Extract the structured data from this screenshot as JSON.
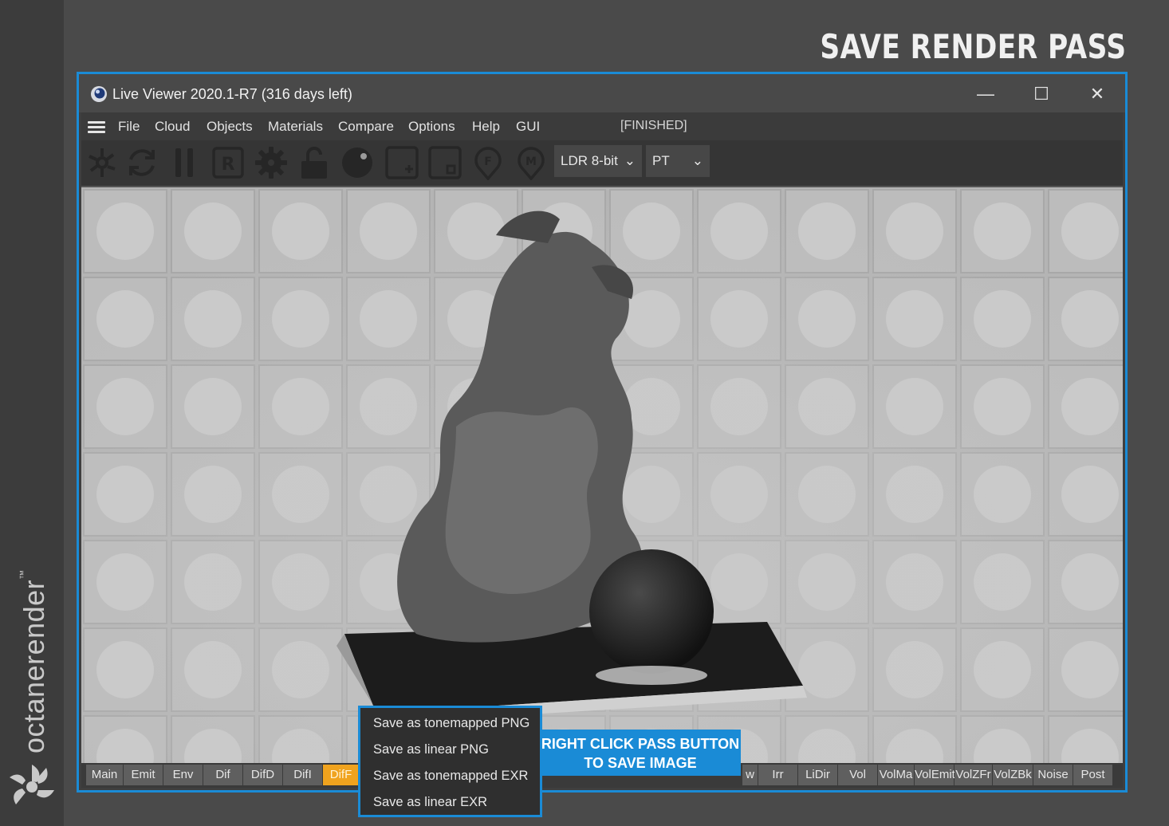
{
  "brand": {
    "name": "octanerender",
    "trademark": "™"
  },
  "page_title": "SAVE RENDER PASS",
  "window": {
    "title": "Live Viewer 2020.1-R7 (316 days left)",
    "minimize_glyph": "—",
    "maximize_glyph": "☐",
    "close_glyph": "✕"
  },
  "menu": {
    "items": [
      "File",
      "Cloud",
      "Objects",
      "Materials",
      "Compare",
      "Options",
      "Help",
      "GUI"
    ],
    "status": "[FINISHED]"
  },
  "toolbar": {
    "tools": [
      {
        "icon": "send-to-render-icon"
      },
      {
        "icon": "reset-icon"
      },
      {
        "icon": "pause-icon"
      },
      {
        "icon": "region-render-icon",
        "letter": "R"
      },
      {
        "icon": "settings-gear-icon"
      },
      {
        "icon": "unlock-icon"
      },
      {
        "icon": "clay-mode-icon"
      },
      {
        "icon": "add-region-icon"
      },
      {
        "icon": "subtract-region-icon"
      },
      {
        "icon": "focus-picker-icon",
        "letter": "F"
      },
      {
        "icon": "material-picker-icon",
        "letter": "M"
      }
    ],
    "color_depth": "LDR 8-bit",
    "render_mode": "PT"
  },
  "passes": {
    "left": [
      "Main",
      "Emit",
      "Env",
      "Dif",
      "DifD",
      "DifI",
      "DifF"
    ],
    "active": "DifF",
    "right_partial": "w",
    "right": [
      "Irr",
      "LiDir",
      "Vol",
      "VolMa",
      "VolEmit",
      "VolZFr",
      "VolZBk",
      "Noise",
      "Post"
    ]
  },
  "context_menu": {
    "items": [
      "Save as tonemapped PNG",
      "Save as linear PNG",
      "Save as tonemapped EXR",
      "Save as linear EXR"
    ]
  },
  "callout": {
    "line1": "RIGHT CLICK PASS BUTTON",
    "line2": "TO SAVE IMAGE"
  },
  "colors": {
    "accent": "#1a8bd6",
    "active_pass": "#f0a31e",
    "background": "#4a4a4a"
  }
}
